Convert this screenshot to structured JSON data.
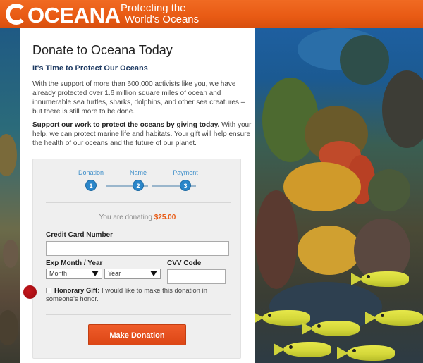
{
  "header": {
    "logo_text": "OCEANA",
    "tagline_line1": "Protecting the",
    "tagline_line2": "World's Oceans"
  },
  "page": {
    "title": "Donate to Oceana Today",
    "subheading": "It's Time to Protect Our Oceans",
    "intro": "With the support of more than 600,000 activists like you, we have already protected over 1.6 million square miles of ocean and innumerable sea turtles, sharks, dolphins, and other sea creatures – but there is still more to be done.",
    "support_bold": "Support our work to protect the oceans by giving today.",
    "support_rest": " With your help, we can protect marine life and habitats. Your gift will help ensure the health of our oceans and the future of our planet."
  },
  "steps": [
    {
      "label": "Donation",
      "number": "1"
    },
    {
      "label": "Name",
      "number": "2"
    },
    {
      "label": "Payment",
      "number": "3"
    }
  ],
  "donation": {
    "prefix": "You are donating",
    "amount": "$25.00"
  },
  "form": {
    "card_label": "Credit Card Number",
    "card_value": "",
    "exp_label": "Exp Month / Year",
    "month_value": "Month",
    "year_value": "Year",
    "cvv_label": "CVV Code",
    "cvv_value": "",
    "honorary_bold": "Honorary Gift:",
    "honorary_rest": " I would like to make this donation in someone's honor.",
    "submit_label": "Make Donation"
  },
  "colors": {
    "brand_orange": "#e85a14",
    "step_blue": "#2b86c9",
    "button_red": "#dc4615"
  }
}
